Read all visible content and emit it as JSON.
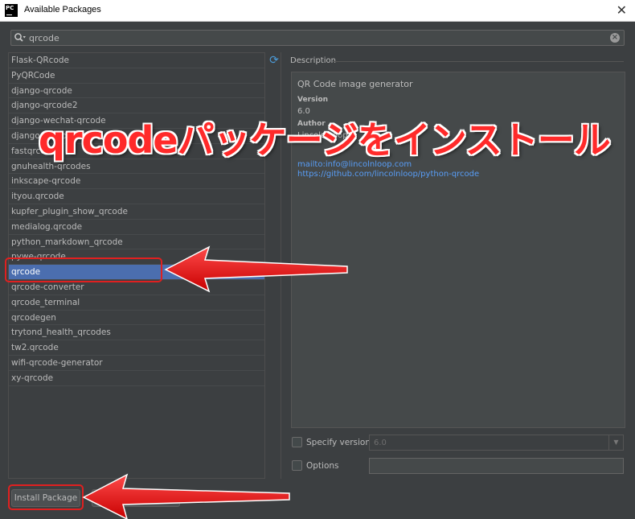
{
  "window": {
    "title": "Available Packages",
    "app_icon_text": "PC",
    "close_glyph": "✕"
  },
  "search": {
    "value": "qrcode",
    "icon": "search-icon",
    "clear_glyph": "×"
  },
  "packages": [
    "Flask-QRcode",
    "PyQRCode",
    "django-qrcode",
    "django-qrcode2",
    "django-wechat-qrcode",
    "django-qrcode",
    "fastqrcode",
    "gnuhealth-qrcodes",
    "inkscape-qrcode",
    "ityou.qrcode",
    "kupfer_plugin_show_qrcode",
    "medialog.qrcode",
    "python_markdown_qrcode",
    "pywe-qrcode",
    "qrcode",
    "qrcode-converter",
    "qrcode_terminal",
    "qrcodegen",
    "trytond_health_qrcodes",
    "tw2.qrcode",
    "wifi-qrcode-generator",
    "xy-qrcode"
  ],
  "selected_index": 14,
  "refresh_glyph": "⟳",
  "description": {
    "header": "Description",
    "summary": "QR Code image generator",
    "version_label": "Version",
    "version": "6.0",
    "author_label": "Author",
    "author": "Lincoln Loop",
    "links": [
      "mailto:info@lincolnloop.com",
      "https://github.com/lincolnloop/python-qrcode"
    ]
  },
  "options": {
    "specify_version_label": "Specify version",
    "version_value": "6.0",
    "options_label": "Options",
    "options_value": "",
    "dropdown_glyph": "▼"
  },
  "buttons": {
    "install": "Install Package"
  },
  "annotation": {
    "banner": "qrcodeパッケージをインストール",
    "color": "#ff2a2a"
  },
  "colors": {
    "background": "#3c3f41",
    "selection": "#4b6eaf",
    "link": "#589df6",
    "text": "#bbbbbb"
  }
}
